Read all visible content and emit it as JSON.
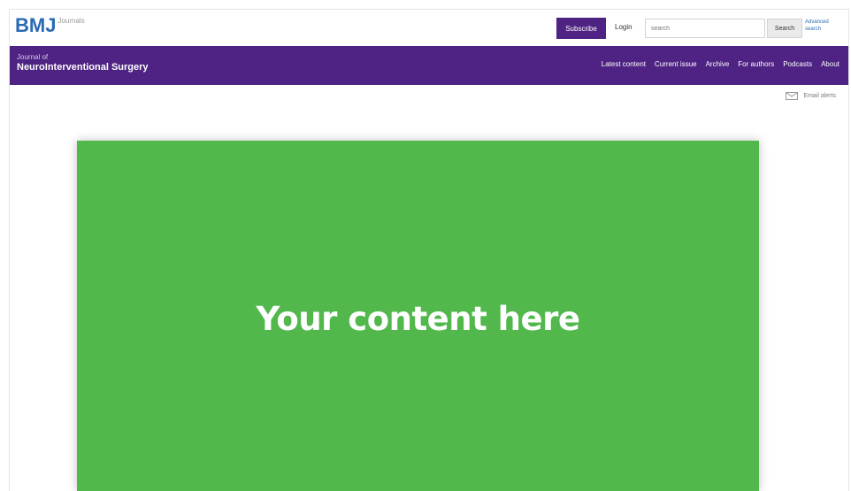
{
  "header": {
    "logo_mark": "BMJ",
    "logo_sub": "Journals",
    "subscribe_label": "Subscribe",
    "login_label": "Login",
    "search_placeholder": "search",
    "search_button_label": "Search",
    "advanced_search_label": "Advanced search"
  },
  "nav": {
    "journal_prefix": "Journal of",
    "journal_name": "NeuroInterventional Surgery",
    "links": [
      {
        "label": "Latest content"
      },
      {
        "label": "Current issue"
      },
      {
        "label": "Archive"
      },
      {
        "label": "For authors"
      },
      {
        "label": "Podcasts"
      },
      {
        "label": "About"
      }
    ]
  },
  "email_alerts": {
    "label": "Email alerts"
  },
  "content": {
    "placeholder_text": "Your content here"
  },
  "colors": {
    "brand_purple": "#4e2383",
    "logo_blue": "#2a6ab3",
    "content_green": "#52b84c"
  }
}
